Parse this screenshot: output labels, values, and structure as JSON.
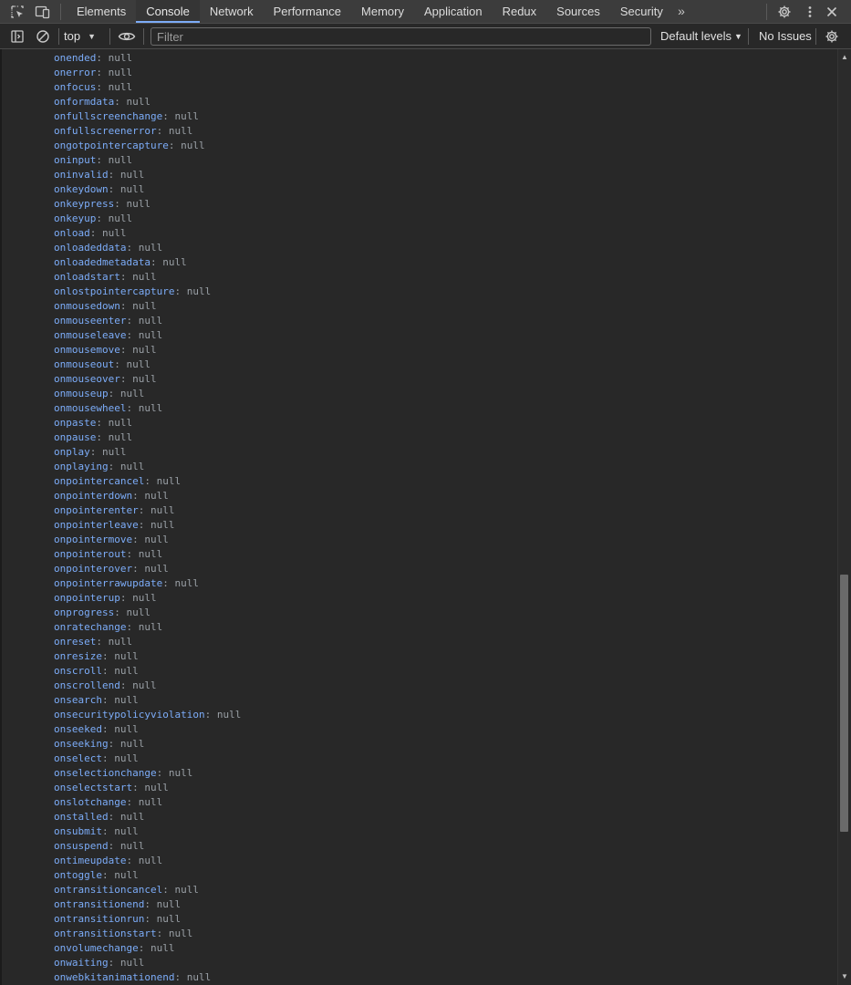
{
  "tabbar": {
    "tabs": [
      {
        "label": "Elements"
      },
      {
        "label": "Console"
      },
      {
        "label": "Network"
      },
      {
        "label": "Performance"
      },
      {
        "label": "Memory"
      },
      {
        "label": "Application"
      },
      {
        "label": "Redux"
      },
      {
        "label": "Sources"
      },
      {
        "label": "Security"
      }
    ],
    "active_tab": "Console",
    "more_tabs_label": "»",
    "icons": [
      "inspect-element-icon",
      "device-toolbar-icon",
      "settings-gear-icon",
      "more-options-icon",
      "close-icon"
    ]
  },
  "console_toolbar": {
    "context": "top",
    "filter_placeholder": "Filter",
    "filter_value": "",
    "levels_label": "Default levels",
    "issues_label": "No Issues",
    "icons": [
      "sidebar-toggle-icon",
      "clear-console-icon",
      "live-expression-eye-icon",
      "console-settings-gear-icon"
    ]
  },
  "colors": {
    "property_name": "#7cacf8",
    "null_value": "#9aa0a6",
    "background": "#282828",
    "active_tab_underline": "#7cacf8"
  },
  "output": {
    "lines": [
      {
        "name": "onended",
        "value": "null"
      },
      {
        "name": "onerror",
        "value": "null"
      },
      {
        "name": "onfocus",
        "value": "null"
      },
      {
        "name": "onformdata",
        "value": "null"
      },
      {
        "name": "onfullscreenchange",
        "value": "null"
      },
      {
        "name": "onfullscreenerror",
        "value": "null"
      },
      {
        "name": "ongotpointercapture",
        "value": "null"
      },
      {
        "name": "oninput",
        "value": "null"
      },
      {
        "name": "oninvalid",
        "value": "null"
      },
      {
        "name": "onkeydown",
        "value": "null"
      },
      {
        "name": "onkeypress",
        "value": "null"
      },
      {
        "name": "onkeyup",
        "value": "null"
      },
      {
        "name": "onload",
        "value": "null"
      },
      {
        "name": "onloadeddata",
        "value": "null"
      },
      {
        "name": "onloadedmetadata",
        "value": "null"
      },
      {
        "name": "onloadstart",
        "value": "null"
      },
      {
        "name": "onlostpointercapture",
        "value": "null"
      },
      {
        "name": "onmousedown",
        "value": "null"
      },
      {
        "name": "onmouseenter",
        "value": "null"
      },
      {
        "name": "onmouseleave",
        "value": "null"
      },
      {
        "name": "onmousemove",
        "value": "null"
      },
      {
        "name": "onmouseout",
        "value": "null"
      },
      {
        "name": "onmouseover",
        "value": "null"
      },
      {
        "name": "onmouseup",
        "value": "null"
      },
      {
        "name": "onmousewheel",
        "value": "null"
      },
      {
        "name": "onpaste",
        "value": "null"
      },
      {
        "name": "onpause",
        "value": "null"
      },
      {
        "name": "onplay",
        "value": "null"
      },
      {
        "name": "onplaying",
        "value": "null"
      },
      {
        "name": "onpointercancel",
        "value": "null"
      },
      {
        "name": "onpointerdown",
        "value": "null"
      },
      {
        "name": "onpointerenter",
        "value": "null"
      },
      {
        "name": "onpointerleave",
        "value": "null"
      },
      {
        "name": "onpointermove",
        "value": "null"
      },
      {
        "name": "onpointerout",
        "value": "null"
      },
      {
        "name": "onpointerover",
        "value": "null"
      },
      {
        "name": "onpointerrawupdate",
        "value": "null"
      },
      {
        "name": "onpointerup",
        "value": "null"
      },
      {
        "name": "onprogress",
        "value": "null"
      },
      {
        "name": "onratechange",
        "value": "null"
      },
      {
        "name": "onreset",
        "value": "null"
      },
      {
        "name": "onresize",
        "value": "null"
      },
      {
        "name": "onscroll",
        "value": "null"
      },
      {
        "name": "onscrollend",
        "value": "null"
      },
      {
        "name": "onsearch",
        "value": "null"
      },
      {
        "name": "onsecuritypolicyviolation",
        "value": "null"
      },
      {
        "name": "onseeked",
        "value": "null"
      },
      {
        "name": "onseeking",
        "value": "null"
      },
      {
        "name": "onselect",
        "value": "null"
      },
      {
        "name": "onselectionchange",
        "value": "null"
      },
      {
        "name": "onselectstart",
        "value": "null"
      },
      {
        "name": "onslotchange",
        "value": "null"
      },
      {
        "name": "onstalled",
        "value": "null"
      },
      {
        "name": "onsubmit",
        "value": "null"
      },
      {
        "name": "onsuspend",
        "value": "null"
      },
      {
        "name": "ontimeupdate",
        "value": "null"
      },
      {
        "name": "ontoggle",
        "value": "null"
      },
      {
        "name": "ontransitioncancel",
        "value": "null"
      },
      {
        "name": "ontransitionend",
        "value": "null"
      },
      {
        "name": "ontransitionrun",
        "value": "null"
      },
      {
        "name": "ontransitionstart",
        "value": "null"
      },
      {
        "name": "onvolumechange",
        "value": "null"
      },
      {
        "name": "onwaiting",
        "value": "null"
      },
      {
        "name": "onwebkitanimationend",
        "value": "null"
      }
    ]
  },
  "scrollbar": {
    "up_arrow": "▲",
    "down_arrow": "▼"
  }
}
